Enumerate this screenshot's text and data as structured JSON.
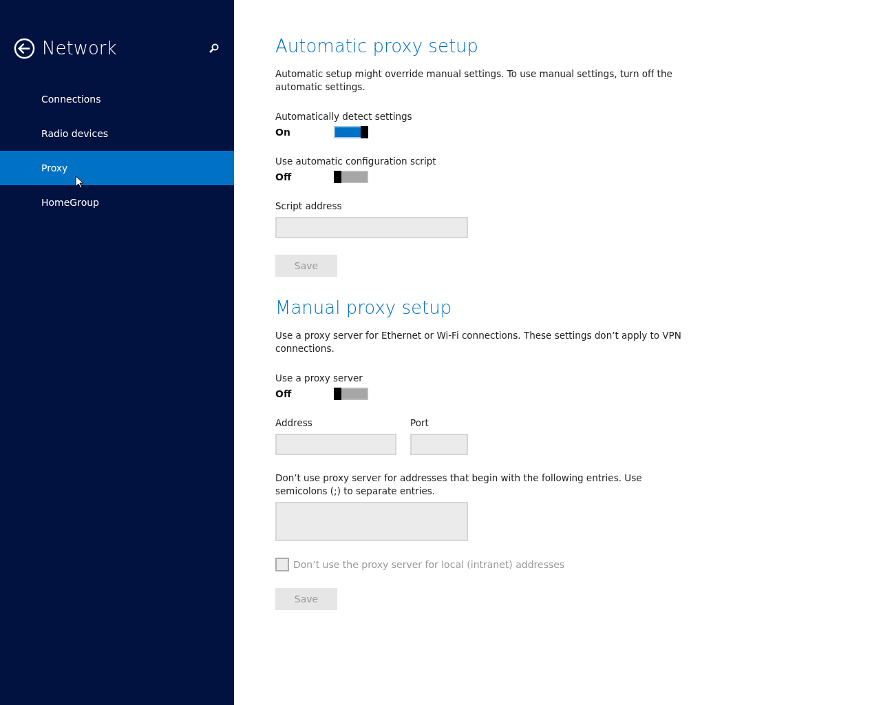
{
  "sidebar": {
    "title": "Network",
    "items": [
      {
        "label": "Connections",
        "selected": false
      },
      {
        "label": "Radio devices",
        "selected": false
      },
      {
        "label": "Proxy",
        "selected": true
      },
      {
        "label": "HomeGroup",
        "selected": false
      }
    ]
  },
  "sections": [
    {
      "title": "Automatic proxy setup",
      "description": "Automatic setup might override manual settings. To use manual settings, turn off the automatic settings.",
      "items": [
        {
          "kind": "toggle",
          "label": "Automatically detect settings",
          "state_text": "On",
          "on": true
        },
        {
          "kind": "toggle",
          "label": "Use automatic configuration script",
          "state_text": "Off",
          "on": false
        },
        {
          "kind": "field",
          "label": "Script address"
        },
        {
          "kind": "button",
          "label": "Save",
          "disabled": true
        }
      ]
    },
    {
      "title": "Manual proxy setup",
      "description": "Use a proxy server for Ethernet or Wi-Fi connections. These settings don’t apply to VPN connections.",
      "items": [
        {
          "kind": "toggle",
          "label": "Use a proxy server",
          "state_text": "Off",
          "on": false
        },
        {
          "kind": "fieldrow",
          "fields": [
            {
              "label": "Address"
            },
            {
              "label": "Port"
            }
          ]
        },
        {
          "kind": "area",
          "label": "Don’t use proxy server for addresses that begin with the following entries. Use semicolons (;) to separate entries."
        },
        {
          "kind": "checkbox",
          "label": "Don’t use the proxy server for local (intranet) addresses",
          "checked": false,
          "disabled": true
        },
        {
          "kind": "button",
          "label": "Save",
          "disabled": true
        }
      ]
    }
  ]
}
